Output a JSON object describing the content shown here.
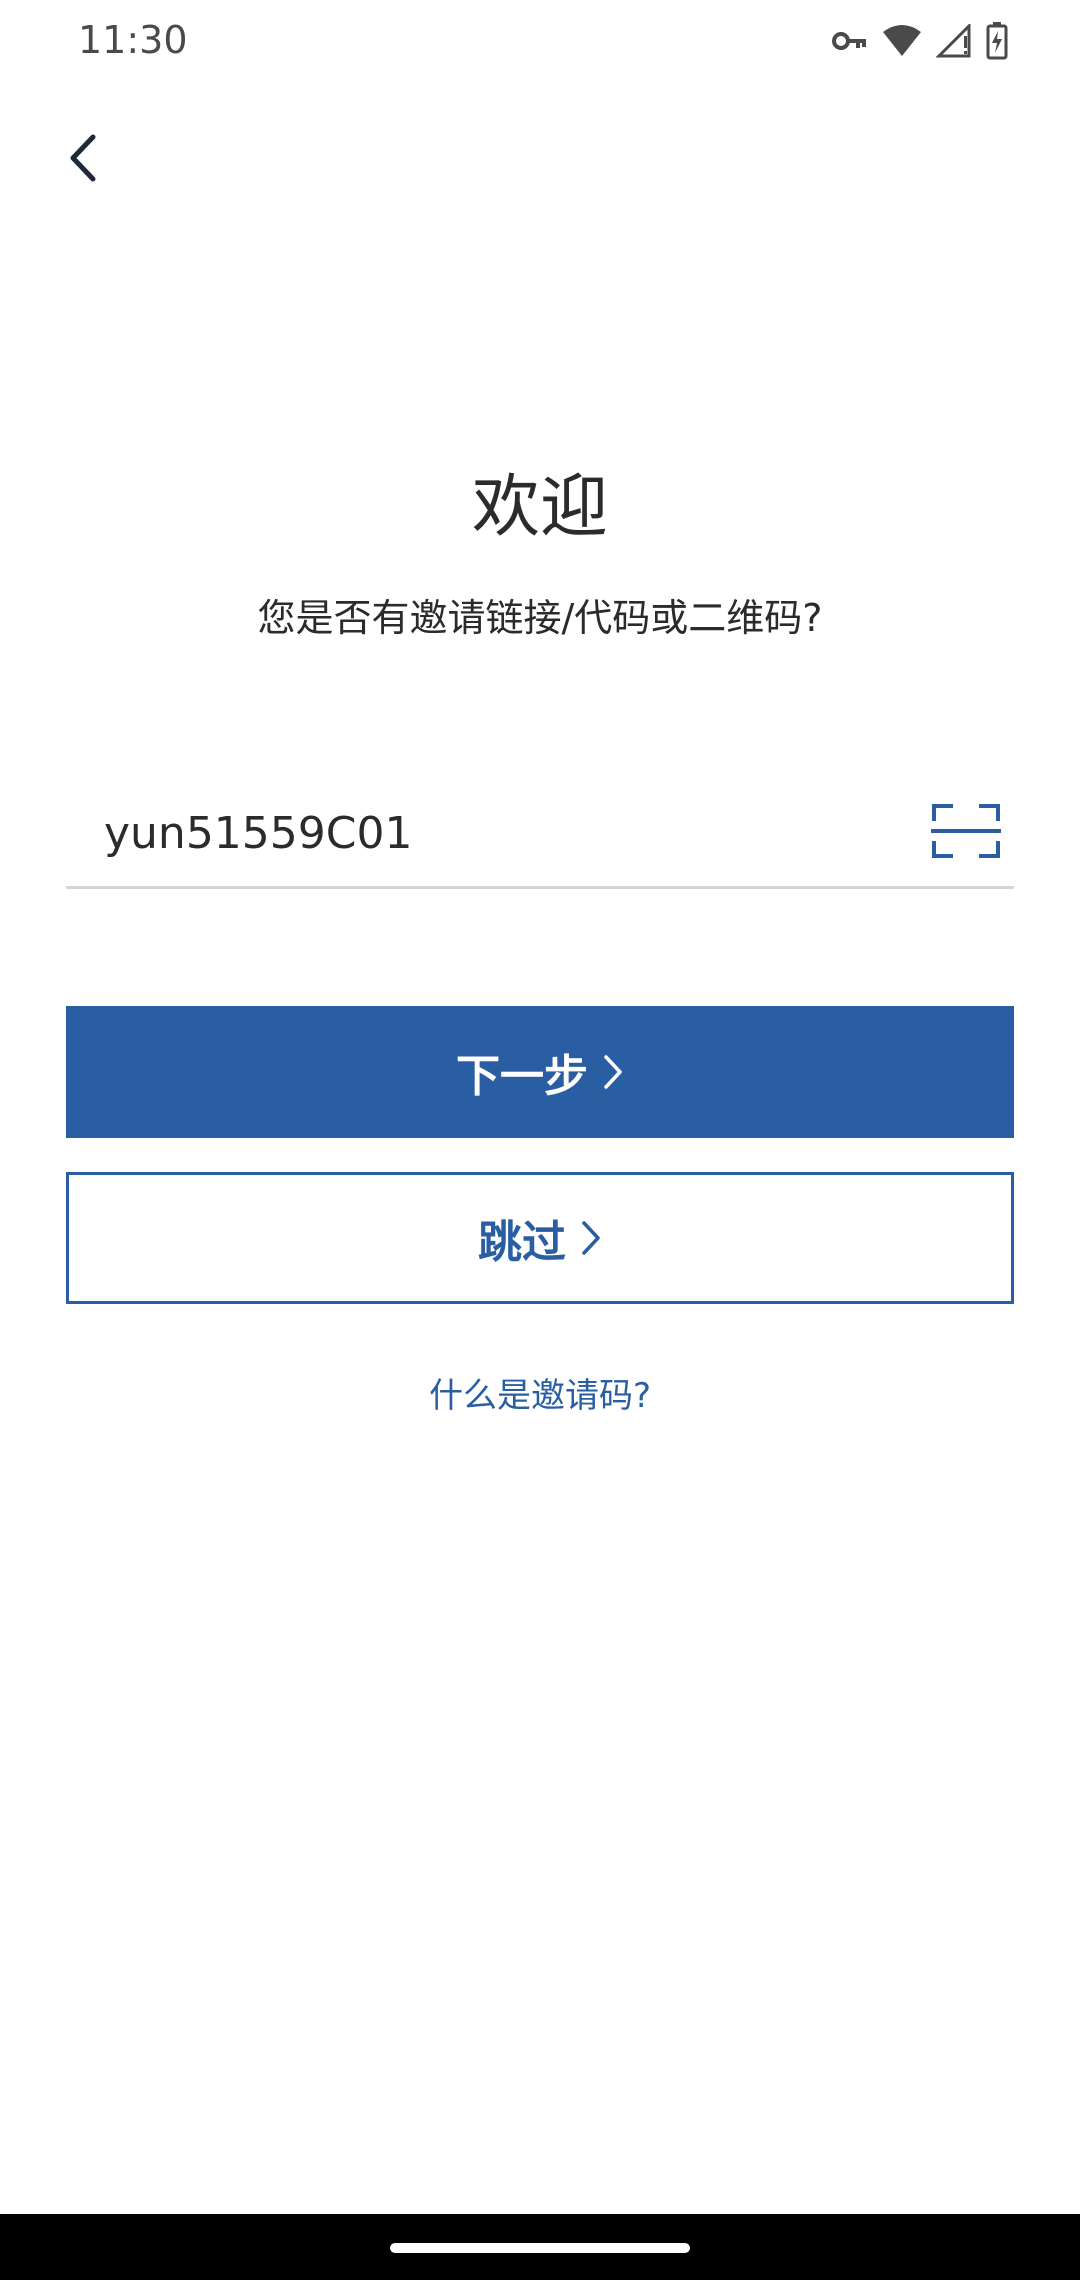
{
  "status_bar": {
    "time": "11:30",
    "icons": [
      "key-icon",
      "wifi-icon",
      "signal-icon",
      "battery-charging-icon"
    ]
  },
  "header": {
    "back_icon": "chevron-left-icon"
  },
  "welcome": {
    "title": "欢迎",
    "subtitle": "您是否有邀请链接/代码或二维码?"
  },
  "invite": {
    "code_value": "yun51559C01",
    "scan_icon": "qr-scan-icon"
  },
  "actions": {
    "next_label": "下一步",
    "skip_label": "跳过",
    "help_link": "什么是邀请码?"
  },
  "colors": {
    "accent": "#2a5ea3",
    "text": "#2b2b2b",
    "divider": "#d4d4d4"
  }
}
